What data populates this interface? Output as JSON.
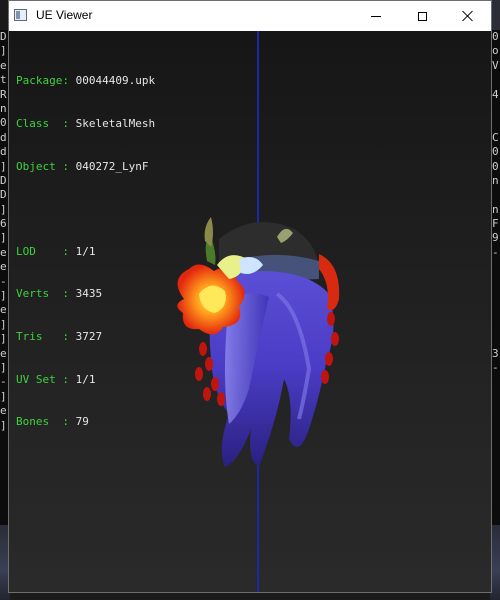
{
  "window": {
    "title": "UE Viewer"
  },
  "info": {
    "package_label": "Package: ",
    "package_value": "00044409.upk",
    "class_label": "Class  : ",
    "class_value": "SkeletalMesh",
    "object_label": "Object : ",
    "object_value": "040272_LynF",
    "lod_label": "LOD    : ",
    "lod_value": "1/1",
    "verts_label": "Verts  : ",
    "verts_value": "3435",
    "tris_label": "Tris   : ",
    "tris_value": "3727",
    "uvset_label": "UV Set : ",
    "uvset_value": "1/1",
    "bones_label": "Bones  : ",
    "bones_value": "79"
  },
  "background_console": {
    "left": [
      "D",
      "]",
      "e",
      "t",
      "R",
      "n",
      "0",
      "d",
      "d",
      "]",
      "D",
      "D",
      "]",
      "6",
      "]",
      "e",
      "e",
      "-",
      "]",
      "e",
      "]",
      "]",
      "e",
      "]",
      "-",
      "]",
      "e",
      "]"
    ],
    "right": [
      "0",
      "o",
      "V",
      "",
      "4",
      "",
      "",
      "C",
      "0",
      "0",
      "n",
      "",
      "n",
      "F",
      "9",
      "-",
      "",
      "",
      "",
      "",
      "",
      "",
      "3",
      "-"
    ]
  },
  "colors": {
    "label_green": "#3ed23e",
    "value_white": "#e6e6e6",
    "axis_blue": "#1a2aa6"
  },
  "icons": {
    "app": "app-window-icon",
    "minimize": "minimize-icon",
    "maximize": "maximize-icon",
    "close": "close-icon"
  }
}
